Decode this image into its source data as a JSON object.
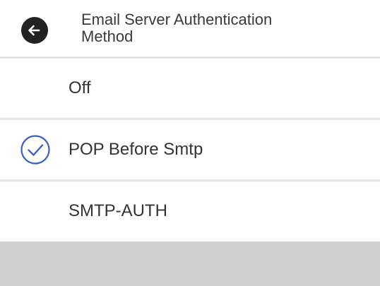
{
  "header": {
    "title_line1": "Email Server Authentication",
    "title_line2": "Method",
    "back_icon": "arrow-left-icon"
  },
  "options": [
    {
      "label": "Off",
      "selected": false
    },
    {
      "label": "POP Before Smtp",
      "selected": true
    },
    {
      "label": "SMTP-AUTH",
      "selected": false
    }
  ],
  "colors": {
    "accent": "#3a62c0",
    "back_button": "#222222",
    "divider": "#e3e3e3",
    "footer": "#cfcfcf"
  }
}
